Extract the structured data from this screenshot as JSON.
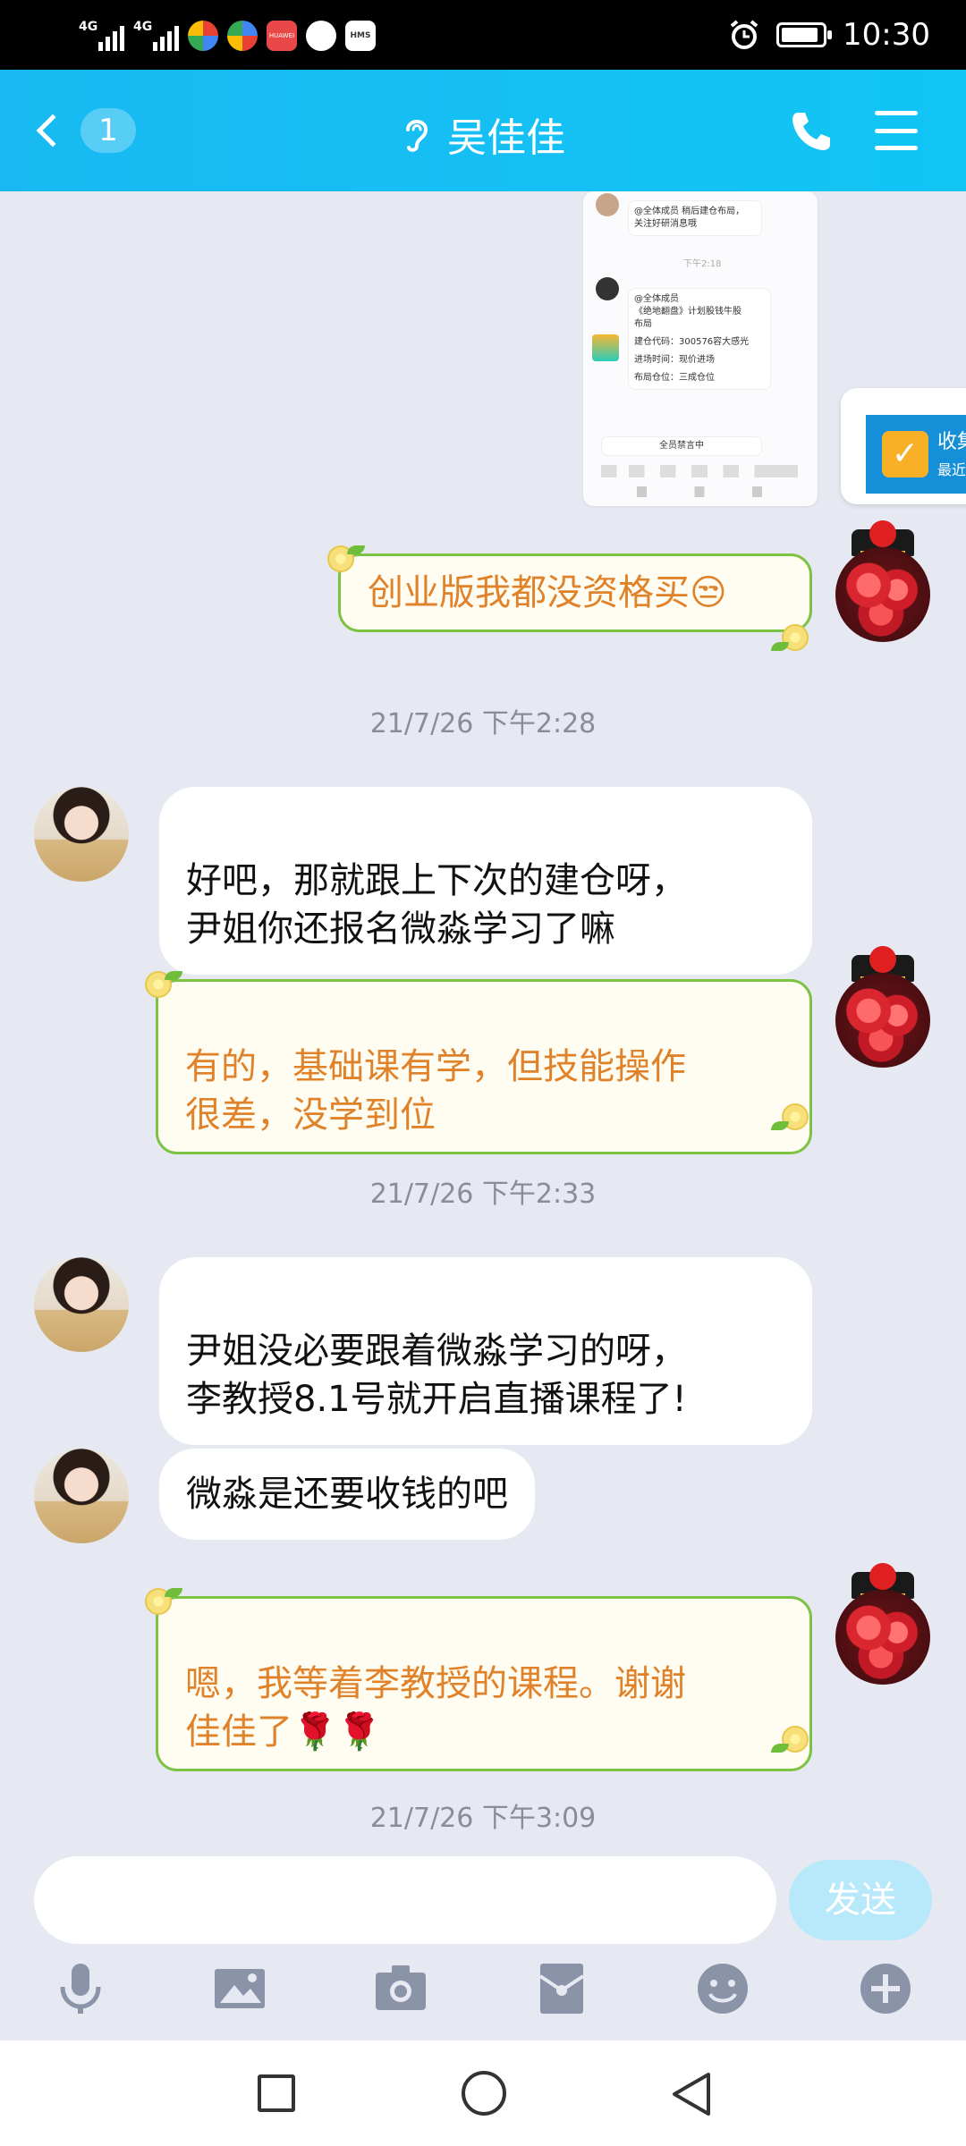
{
  "status_bar": {
    "network1": "4G",
    "network2": "4G",
    "app_badge_1": "HUAWEI",
    "app_badge_2": "HMS",
    "time": "10:30"
  },
  "header": {
    "unread_count": "1",
    "contact_name": "吴佳佳"
  },
  "shared_screenshot": {
    "line1": "@全体成员 稍后建仓布局，",
    "line2": "关注好研消息哦",
    "mid_time": "下午2:18",
    "line3": "@全体成员",
    "line4": "《绝地翻盘》计划股钱牛股",
    "line5": "布局",
    "line6": "建仓代码：300576容大感光",
    "line7": "进场时间：现价进场",
    "line8": "布局仓位：三成仓位",
    "banner": "全员禁言中"
  },
  "toast": {
    "title": "收集",
    "subtitle": "最近"
  },
  "messages": [
    {
      "type": "out",
      "text": "创业版我都没资格买😒"
    },
    {
      "type": "time",
      "text": "21/7/26 下午2:28"
    },
    {
      "type": "in",
      "text": "好吧，那就跟上下次的建仓呀，\n尹姐你还报名微淼学习了嘛"
    },
    {
      "type": "out",
      "text": "有的，基础课有学，但技能操作\n很差，没学到位"
    },
    {
      "type": "time",
      "text": "21/7/26 下午2:33"
    },
    {
      "type": "in",
      "text": "尹姐没必要跟着微淼学习的呀，\n李教授8.1号就开启直播课程了!"
    },
    {
      "type": "in",
      "text": "微淼是还要收钱的吧"
    },
    {
      "type": "out",
      "text": "嗯，我等着李教授的课程。谢谢\n佳佳了🌹🌹"
    },
    {
      "type": "time",
      "text": "21/7/26 下午3:09"
    }
  ],
  "input": {
    "placeholder": "",
    "send_label": "发送"
  },
  "icons": {
    "back": "chevron-left-icon",
    "voice_call_mode": "ear-icon",
    "call": "phone-icon",
    "menu": "menu-icon",
    "toolbar": [
      "microphone-icon",
      "image-icon",
      "camera-icon",
      "red-packet-icon",
      "emoji-icon",
      "plus-icon"
    ]
  },
  "colors": {
    "header": "#18b9f2",
    "out_bubble_text": "#e0822a",
    "out_bubble_border": "#7cc243",
    "send_button": "#b8e9fb"
  }
}
